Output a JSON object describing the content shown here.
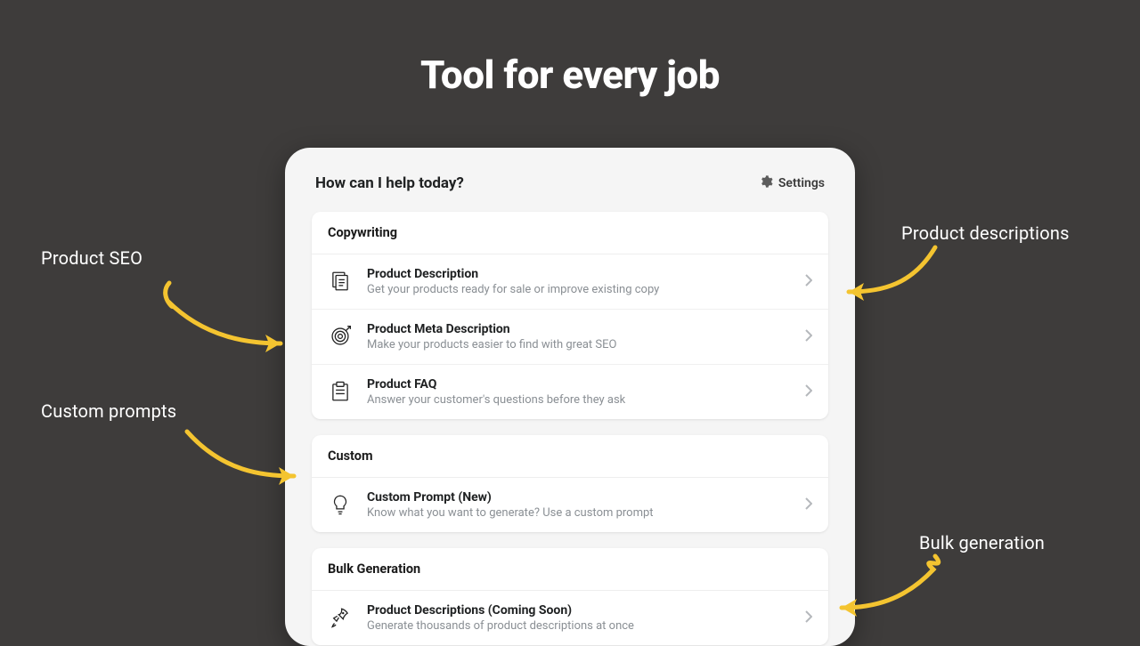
{
  "headline": "Tool for every job",
  "panel": {
    "title": "How can I help today?",
    "settings_label": "Settings"
  },
  "sections": {
    "copywriting": {
      "title": "Copywriting",
      "items": [
        {
          "title": "Product Description",
          "subtitle": "Get your products ready for sale or improve existing copy"
        },
        {
          "title": "Product Meta Description",
          "subtitle": "Make your products easier to find with great SEO"
        },
        {
          "title": "Product FAQ",
          "subtitle": "Answer your customer's questions before they ask"
        }
      ]
    },
    "custom": {
      "title": "Custom",
      "items": [
        {
          "title": "Custom Prompt (New)",
          "subtitle": "Know what you want to generate? Use a custom prompt"
        }
      ]
    },
    "bulk": {
      "title": "Bulk Generation",
      "items": [
        {
          "title": "Product Descriptions (Coming Soon)",
          "subtitle": "Generate thousands of product descriptions at once"
        }
      ]
    }
  },
  "callouts": {
    "seo": "Product SEO",
    "prompts": "Custom prompts",
    "descriptions": "Product descriptions",
    "bulk": "Bulk generation"
  }
}
